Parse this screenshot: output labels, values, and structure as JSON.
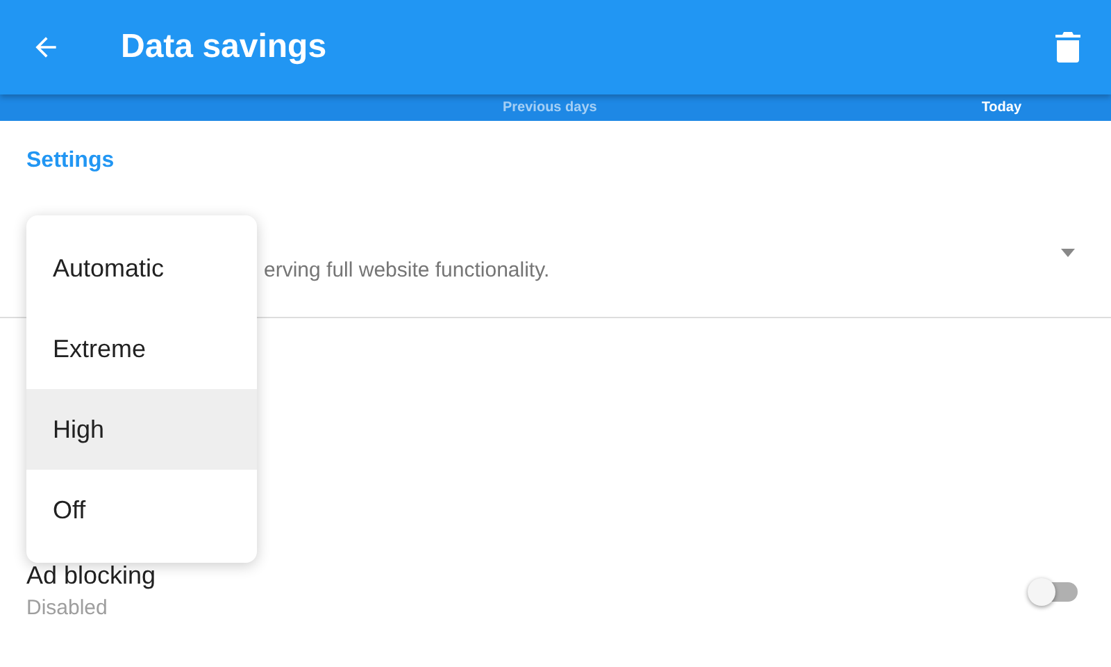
{
  "app_bar": {
    "title": "Data savings"
  },
  "chart_strip": {
    "labels": [
      "Previous days",
      "Today"
    ]
  },
  "settings": {
    "header": "Settings",
    "mode_row": {
      "description": "erving full website functionality."
    },
    "ad_blocking": {
      "title": "Ad blocking",
      "subtitle": "Disabled",
      "on": false
    }
  },
  "menu": {
    "items": [
      {
        "label": "Automatic",
        "selected": false
      },
      {
        "label": "Extreme",
        "selected": false
      },
      {
        "label": "High",
        "selected": true
      },
      {
        "label": "Off",
        "selected": false
      }
    ]
  }
}
